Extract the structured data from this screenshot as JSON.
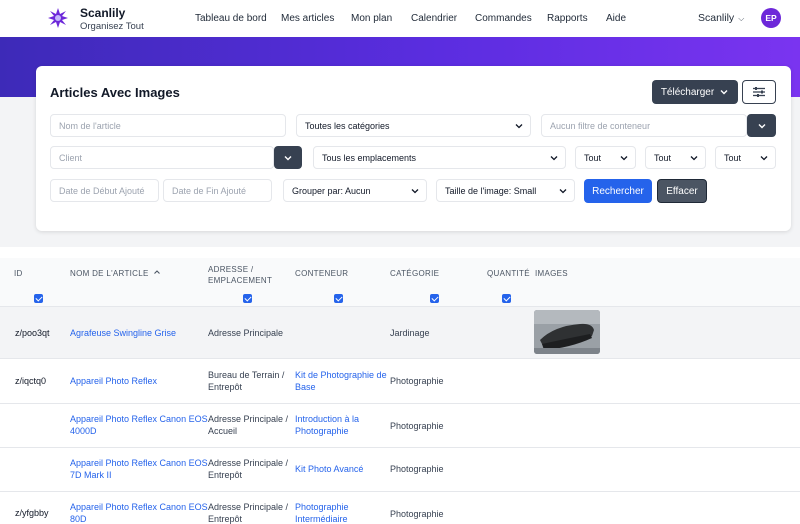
{
  "brand": {
    "name": "Scanlily",
    "tagline": "Organisez Tout"
  },
  "nav": [
    "Tableau de bord",
    "Mes articles",
    "Mon plan",
    "Calendrier",
    "Commandes",
    "Rapports",
    "Aide"
  ],
  "user": {
    "name": "Scanlily",
    "initials": "EP"
  },
  "card": {
    "title": "Articles Avec Images",
    "download_label": "Télécharger",
    "filters": {
      "item_name_placeholder": "Nom de l'article",
      "categories": "Toutes les catégories",
      "container_placeholder": "Aucun filtre de conteneur",
      "client_placeholder": "Client",
      "locations": "Tous les emplacements",
      "all1": "Tout",
      "all2": "Tout",
      "all3": "Tout",
      "start_date_placeholder": "Date de Début Ajouté",
      "end_date_placeholder": "Date de Fin Ajouté",
      "group_by": "Grouper par: Aucun",
      "image_size": "Taille de l'image: Small",
      "search_label": "Rechercher",
      "clear_label": "Effacer"
    }
  },
  "table": {
    "headers": {
      "id": "ID",
      "name": "NOM DE L'ARTICLE",
      "address_1": "ADRESSE /",
      "address_2": "EMPLACEMENT",
      "container": "CONTENEUR",
      "category": "CATÉGORIE",
      "quantity": "QUANTITÉ",
      "images": "IMAGES"
    },
    "rows": [
      {
        "id": "z/poo3qt",
        "name_1": "Agrafeuse Swingline Grise",
        "name_2": "",
        "addr_1": "Adresse Principale",
        "addr_2": "",
        "cont_1": "",
        "cont_2": "",
        "category": "Jardinage"
      },
      {
        "id": "z/iqctq0",
        "name_1": "Appareil Photo Reflex",
        "name_2": "",
        "addr_1": "Bureau de Terrain /",
        "addr_2": "Entrepôt",
        "cont_1": "Kit de Photographie de",
        "cont_2": "Base",
        "category": "Photographie"
      },
      {
        "id": "",
        "name_1": "Appareil Photo Reflex Canon EOS",
        "name_2": "4000D",
        "addr_1": "Adresse Principale /",
        "addr_2": "Accueil",
        "cont_1": "Introduction à la",
        "cont_2": "Photographie",
        "category": "Photographie"
      },
      {
        "id": "",
        "name_1": "Appareil Photo Reflex Canon EOS",
        "name_2": "7D Mark II",
        "addr_1": "Adresse Principale /",
        "addr_2": "Entrepôt",
        "cont_1": "Kit Photo Avancé",
        "cont_2": "",
        "category": "Photographie"
      },
      {
        "id": "z/yfgbby",
        "name_1": "Appareil Photo Reflex Canon EOS",
        "name_2": "80D",
        "addr_1": "Adresse Principale /",
        "addr_2": "Entrepôt",
        "cont_1": "Photographie",
        "cont_2": "Intermédiaire",
        "category": "Photographie"
      }
    ]
  },
  "colors": {
    "accent": "#2563eb",
    "brand": "#6d28d9",
    "band_start": "#3d2ab8",
    "band_end": "#7a34f0"
  }
}
